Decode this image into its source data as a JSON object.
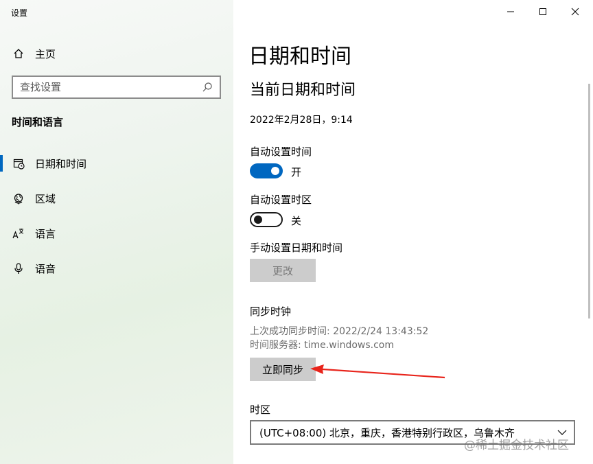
{
  "window": {
    "title": "设置",
    "controls": {
      "minimize": "minimize-icon",
      "maximize": "maximize-icon",
      "close": "close-icon"
    }
  },
  "sidebar": {
    "home_label": "主页",
    "search_placeholder": "查找设置",
    "section_title": "时间和语言",
    "items": [
      {
        "label": "日期和时间",
        "icon": "calendar-clock-icon",
        "active": true
      },
      {
        "label": "区域",
        "icon": "globe-icon",
        "active": false
      },
      {
        "label": "语言",
        "icon": "language-icon",
        "active": false
      },
      {
        "label": "语音",
        "icon": "microphone-icon",
        "active": false
      }
    ]
  },
  "main": {
    "page_title": "日期和时间",
    "subtitle": "当前日期和时间",
    "current_datetime": "2022年2月28日，9:14",
    "auto_time": {
      "label": "自动设置时间",
      "state": "开"
    },
    "auto_timezone": {
      "label": "自动设置时区",
      "state": "关"
    },
    "manual": {
      "label": "手动设置日期和时间",
      "button": "更改"
    },
    "sync": {
      "label": "同步时钟",
      "last_sync": "上次成功同步时间: 2022/2/24 13:43:52",
      "server": "时间服务器: time.windows.com",
      "button": "立即同步"
    },
    "timezone": {
      "label": "时区",
      "selected": "(UTC+08:00) 北京，重庆，香港特别行政区，乌鲁木齐"
    }
  },
  "watermark": "@稀土掘金技术社区",
  "colors": {
    "accent": "#0067c0",
    "arrow": "#e8241b"
  }
}
